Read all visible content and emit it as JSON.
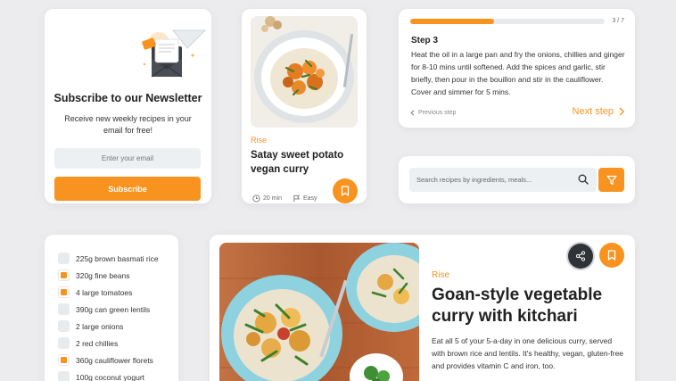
{
  "newsletter": {
    "title": "Subscribe to our Newsletter",
    "description": "Receive new weekly recipes in your email for free!",
    "email_placeholder": "Enter your email",
    "subscribe_label": "Subscribe"
  },
  "recipe_card": {
    "tag": "Rise",
    "name": "Satay sweet potato vegan curry",
    "time": "20 min",
    "difficulty": "Easy"
  },
  "steps": {
    "counter": "3 / 7",
    "progress_fraction": 0.43,
    "title": "Step 3",
    "text": "Heat the oil in a large pan and fry the onions, chillies and ginger for 8-10 mins until softened. Add the spices and garlic, stir briefly, then pour in the bouillon and stir in the cauliflower. Cover and simmer for 5 mins.",
    "prev_label": "Previous step",
    "next_label": "Next step"
  },
  "search": {
    "placeholder": "Search recipes by ingredients, meals..."
  },
  "ingredients": {
    "items": [
      {
        "label": "225g brown basmati rice",
        "checked": false
      },
      {
        "label": "320g fine beans",
        "checked": true
      },
      {
        "label": "4 large tomatoes",
        "checked": true
      },
      {
        "label": "390g can green lentils",
        "checked": false
      },
      {
        "label": "2 large onions",
        "checked": false
      },
      {
        "label": "2 red chillies",
        "checked": false
      },
      {
        "label": "360g cauliflower florets",
        "checked": true
      },
      {
        "label": "100g coconut yogurt",
        "checked": false
      }
    ]
  },
  "featured": {
    "tag": "Rise",
    "name": "Goan-style vegetable curry with kitchari",
    "description": "Eat all 5 of your 5-a-day in one delicious curry, served with brown rice and lentils. It's healthy, vegan, gluten-free and provides vitamin C and iron, too."
  },
  "colors": {
    "accent": "#f7931e",
    "background": "#ececee",
    "dark_button": "#2f3236"
  },
  "icons": {
    "newsletter": "envelope-paper-plane-icon",
    "bookmark": "bookmark-icon",
    "clock": "clock-icon",
    "flag": "flag-icon",
    "search": "search-icon",
    "filter": "filter-icon",
    "share": "share-icon",
    "chevron_left": "chevron-left-icon",
    "chevron_right": "chevron-right-icon"
  }
}
